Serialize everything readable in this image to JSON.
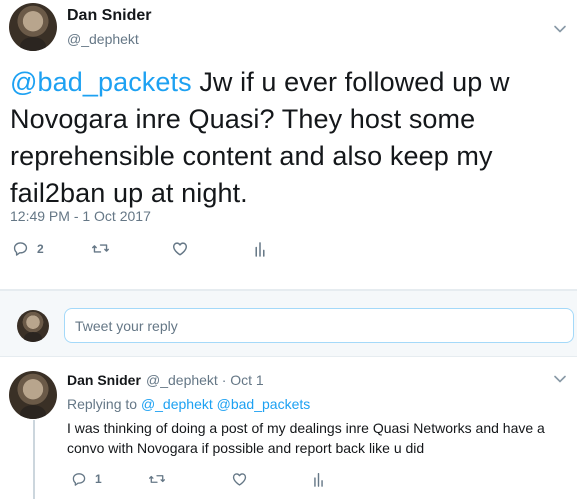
{
  "tweet": {
    "display_name": "Dan Snider",
    "handle": "@_dephekt",
    "text_mention": "@bad_packets",
    "text_body": " Jw if u ever followed up w Novogara inre Quasi? They host some reprehensible content and also keep my fail2ban up at night.",
    "timestamp": "12:49 PM - 1 Oct 2017",
    "reply_count": "2",
    "icons": [
      "reply-icon",
      "retweet-icon",
      "like-icon",
      "analytics-icon",
      "chevron-down-icon"
    ]
  },
  "reply_composer": {
    "placeholder": "Tweet your reply"
  },
  "reply": {
    "display_name": "Dan Snider",
    "meta": "@_dephekt · Oct 1",
    "replying_label": "Replying to ",
    "replying_mentions": "@_dephekt @bad_packets",
    "text": "I was thinking of doing a post of my dealings inre Quasi Networks and have a convo with Novogara if possible and report back like u did",
    "reply_count": "1"
  },
  "colors": {
    "accent": "#1da1f2",
    "secondary_text": "#657786",
    "background_band": "#f5f8fa"
  }
}
